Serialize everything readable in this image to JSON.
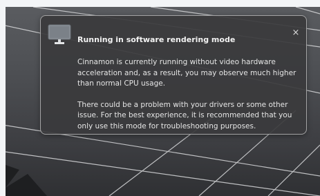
{
  "notification": {
    "icon": "monitor-icon",
    "title": "Running in software rendering mode",
    "close_glyph": "×",
    "paragraphs": [
      "Cinnamon is currently running without video hardware acceleration and, as a result, you may observe much higher than normal CPU usage.",
      "There could be a problem with your drivers or some other issue.  For the best experience, it is recommended that you only use this mode for troubleshooting purposes."
    ]
  },
  "colors": {
    "wallpaper": "#4d4f53",
    "notification_background": "#3a3a3c",
    "notification_border": "#c8c8c8",
    "text": "#e6e6e6"
  }
}
